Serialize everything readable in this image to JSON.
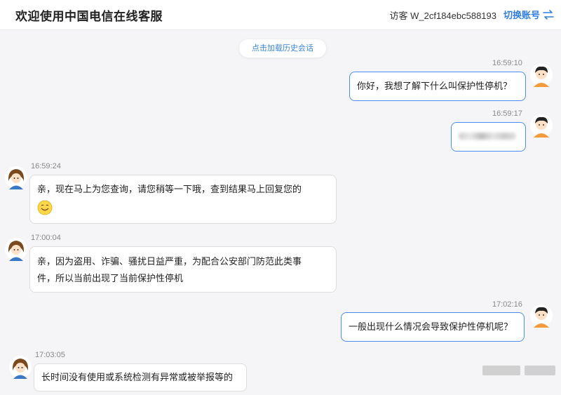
{
  "header": {
    "title": "欢迎使用中国电信在线客服",
    "visitor": "访客 W_2cf184ebc588193",
    "switch_label": "切换账号",
    "switch_icon": "swap-arrows-icon",
    "accent_color": "#2f7de1"
  },
  "history_link": "点击加载历史会话",
  "messages": [
    {
      "sender": "user",
      "time": "16:59:10",
      "text": "你好，我想了解下什么叫保护性停机？"
    },
    {
      "sender": "user",
      "time": "16:59:17",
      "text": ""
    },
    {
      "sender": "agent",
      "time": "16:59:24",
      "text": "亲，现在马上为您查询，请您稍等一下哦，查到结果马上回复您的"
    },
    {
      "sender": "agent",
      "time": "17:00:04",
      "line1": "亲，因为盗用、诈骗、骚扰日益严重，为配合公安部门防范此类事",
      "line2": "件，所以当前出现了当前保护性停机"
    },
    {
      "sender": "user",
      "time": "17:02:16",
      "text": "一般出现什么情况会导致保护性停机呢？"
    },
    {
      "sender": "agent",
      "time": "17:03:05",
      "text": "长时间没有使用或系统检测有异常或被举报等的"
    }
  ]
}
